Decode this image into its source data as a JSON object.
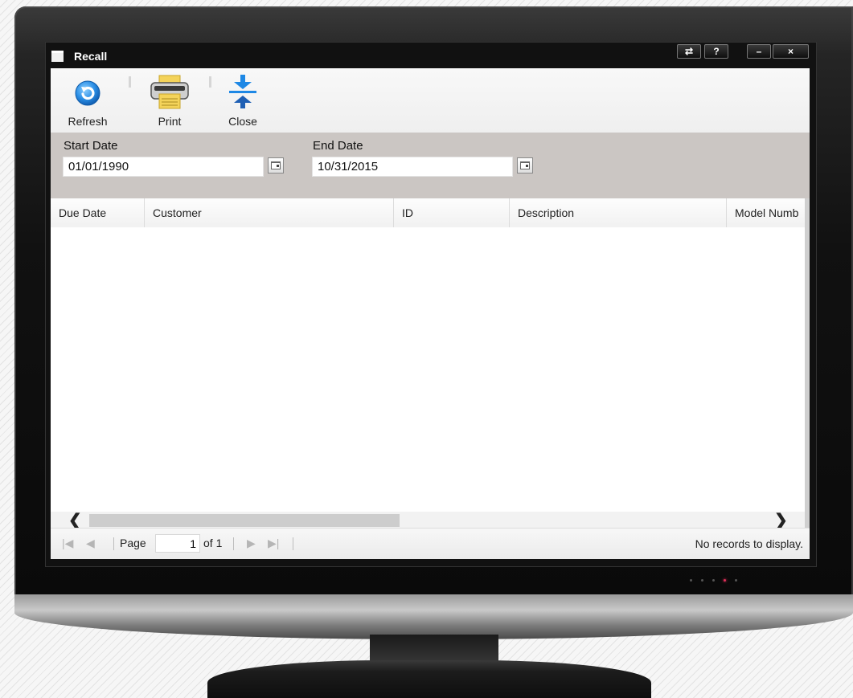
{
  "window": {
    "title": "Recall",
    "buttons": {
      "swap": "⇄",
      "help": "?",
      "minimize": "–",
      "close": "×"
    }
  },
  "toolbar": {
    "refresh_label": "Refresh",
    "print_label": "Print",
    "close_label": "Close"
  },
  "filters": {
    "start_label": "Start Date",
    "start_value": "01/01/1990",
    "end_label": "End Date",
    "end_value": "10/31/2015"
  },
  "grid": {
    "columns": [
      "Due Date",
      "Customer",
      "ID",
      "Description",
      "Model Numb"
    ],
    "rows": []
  },
  "scrollbar": {
    "left_arrow": "❮",
    "right_arrow": "❯"
  },
  "pager": {
    "first": "|◀",
    "prev": "◀",
    "page_label": "Page",
    "page_value": "1",
    "of_label": "of 1",
    "next": "▶",
    "last": "▶|",
    "status": "No records to display."
  },
  "colors": {
    "accent_blue": "#1e88e5",
    "filter_panel": "#cbc6c3",
    "window_frame": "#111111"
  }
}
